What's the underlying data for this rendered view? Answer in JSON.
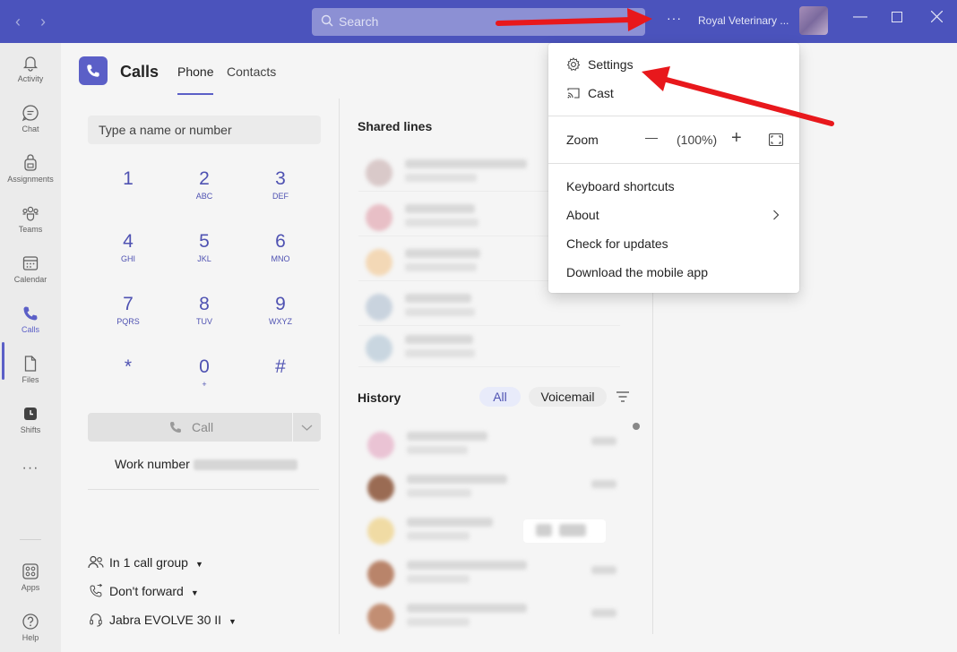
{
  "titlebar": {
    "search_placeholder": "Search",
    "more_label": "···",
    "org_name": "Royal Veterinary ..."
  },
  "rail": {
    "items": [
      {
        "label": "Activity"
      },
      {
        "label": "Chat"
      },
      {
        "label": "Assignments"
      },
      {
        "label": "Teams"
      },
      {
        "label": "Calendar"
      },
      {
        "label": "Calls"
      },
      {
        "label": "Files"
      },
      {
        "label": "Shifts"
      },
      {
        "label": "Apps"
      },
      {
        "label": "Help"
      }
    ],
    "more": "···"
  },
  "header": {
    "title": "Calls",
    "tabs": [
      {
        "label": "Phone"
      },
      {
        "label": "Contacts"
      }
    ],
    "active_tab": "Phone"
  },
  "dialpad": {
    "placeholder": "Type a name or number",
    "keys": [
      {
        "num": "1",
        "sub": ""
      },
      {
        "num": "2",
        "sub": "ABC"
      },
      {
        "num": "3",
        "sub": "DEF"
      },
      {
        "num": "4",
        "sub": "GHI"
      },
      {
        "num": "5",
        "sub": "JKL"
      },
      {
        "num": "6",
        "sub": "MNO"
      },
      {
        "num": "7",
        "sub": "PQRS"
      },
      {
        "num": "8",
        "sub": "TUV"
      },
      {
        "num": "9",
        "sub": "WXYZ"
      },
      {
        "num": "*",
        "sub": ""
      },
      {
        "num": "0",
        "sub": "+"
      },
      {
        "num": "#",
        "sub": ""
      }
    ],
    "call_label": "Call",
    "work_number_label": "Work number",
    "options": [
      {
        "label": "In 1 call group"
      },
      {
        "label": "Don't forward"
      },
      {
        "label": "Jabra EVOLVE 30 II"
      }
    ]
  },
  "shared_lines": {
    "title": "Shared lines"
  },
  "history": {
    "title": "History",
    "filters": [
      {
        "label": "All"
      },
      {
        "label": "Voicemail"
      }
    ],
    "active_filter": "All"
  },
  "menu": {
    "items": [
      {
        "label": "Settings"
      },
      {
        "label": "Cast"
      }
    ],
    "zoom": {
      "label": "Zoom",
      "minus": "—",
      "value": "(100%)",
      "plus": "+"
    },
    "items2": [
      {
        "label": "Keyboard shortcuts"
      },
      {
        "label": "About"
      },
      {
        "label": "Check for updates"
      },
      {
        "label": "Download the mobile app"
      }
    ]
  },
  "colors": {
    "brand": "#4b53bc",
    "accent": "#5b5fc7",
    "annotation": "#e8181c"
  }
}
